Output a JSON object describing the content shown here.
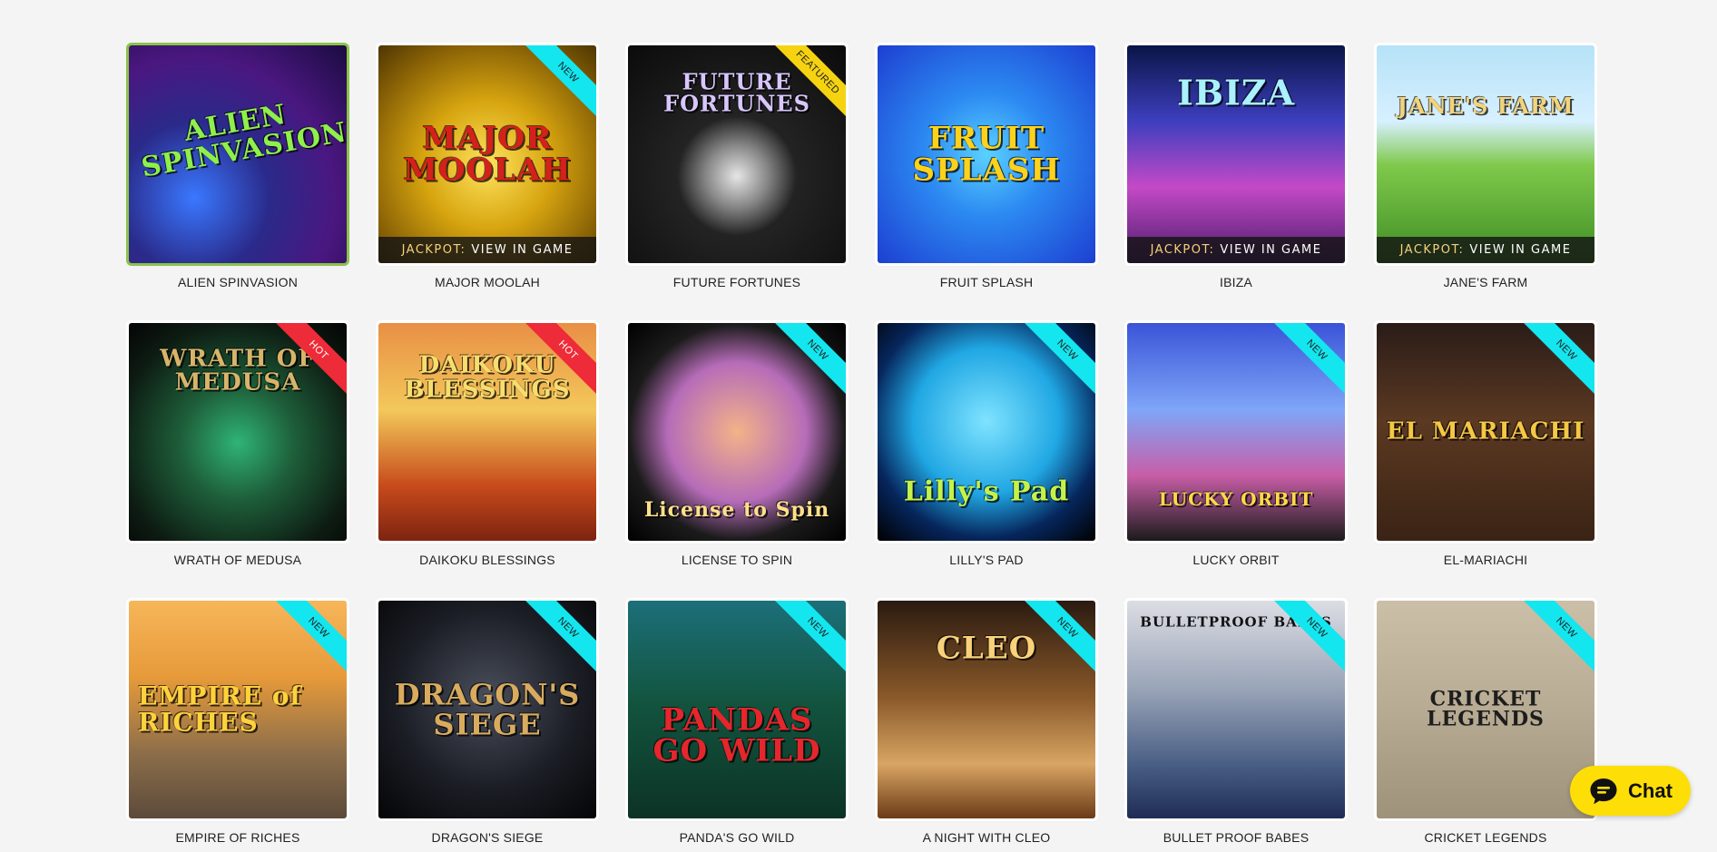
{
  "games": [
    {
      "name": "ALIEN SPINVASION",
      "art_title": "ALIEN SPINVASION!",
      "badge": "",
      "jackpot": false,
      "selected": true
    },
    {
      "name": "MAJOR MOOLAH",
      "art_title": "MAJOR MOOLAH",
      "badge": "NEW",
      "jackpot": true,
      "selected": false
    },
    {
      "name": "FUTURE FORTUNES",
      "art_title": "FUTURE FORTUNES",
      "badge": "FEATURED",
      "jackpot": false,
      "selected": false
    },
    {
      "name": "FRUIT SPLASH",
      "art_title": "FRUIT SPLASH",
      "badge": "",
      "jackpot": false,
      "selected": false
    },
    {
      "name": "IBIZA",
      "art_title": "IBIZA",
      "badge": "",
      "jackpot": true,
      "selected": false
    },
    {
      "name": "JANE'S FARM",
      "art_title": "JANE'S FARM",
      "badge": "",
      "jackpot": true,
      "selected": false
    },
    {
      "name": "WRATH OF MEDUSA",
      "art_title": "WRATH OF MEDUSA",
      "badge": "HOT",
      "jackpot": false,
      "selected": false
    },
    {
      "name": "DAIKOKU BLESSINGS",
      "art_title": "DAIKOKU BLESSINGS",
      "badge": "HOT",
      "jackpot": false,
      "selected": false
    },
    {
      "name": "LICENSE TO SPIN",
      "art_title": "License to Spin",
      "badge": "NEW",
      "jackpot": false,
      "selected": false
    },
    {
      "name": "LILLY'S PAD",
      "art_title": "Lilly's Pad",
      "badge": "NEW",
      "jackpot": false,
      "selected": false
    },
    {
      "name": "LUCKY ORBIT",
      "art_title": "LUCKY ORBIT",
      "badge": "NEW",
      "jackpot": false,
      "selected": false
    },
    {
      "name": "EL-MARIACHI",
      "art_title": "EL MARIACHI",
      "badge": "NEW",
      "jackpot": false,
      "selected": false
    },
    {
      "name": "EMPIRE OF RICHES",
      "art_title": "EMPIRE of RICHES",
      "badge": "NEW",
      "jackpot": false,
      "selected": false
    },
    {
      "name": "DRAGON'S SIEGE",
      "art_title": "DRAGON'S SIEGE",
      "badge": "NEW",
      "jackpot": false,
      "selected": false
    },
    {
      "name": "PANDA'S GO WILD",
      "art_title": "PANDAS GO WILD",
      "badge": "NEW",
      "jackpot": false,
      "selected": false
    },
    {
      "name": "A NIGHT WITH CLEO",
      "art_title": "CLEO",
      "badge": "NEW",
      "jackpot": false,
      "selected": false
    },
    {
      "name": "BULLET PROOF BABES",
      "art_title": "BULLETPROOF BABES",
      "badge": "NEW",
      "jackpot": false,
      "selected": false
    },
    {
      "name": "CRICKET LEGENDS",
      "art_title": "CRICKET LEGENDS",
      "badge": "NEW",
      "jackpot": false,
      "selected": false
    }
  ],
  "jackpot_label": "JACKPOT:",
  "jackpot_text": "VIEW IN GAME",
  "chat": {
    "label": "Chat"
  },
  "colors": {
    "page_bg": "#f4f4f4",
    "badge_new": "#13e6ef",
    "badge_hot": "#ee2b38",
    "badge_featured": "#f5d311",
    "chat_bg": "#fdde07",
    "selected_border": "#8bc34a"
  }
}
